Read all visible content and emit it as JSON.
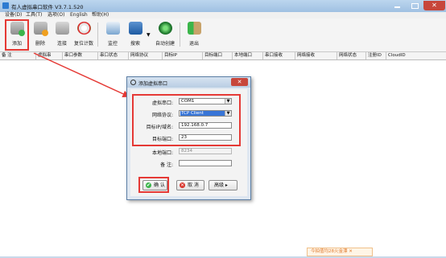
{
  "window": {
    "title": "有人虚拟串口软件 V3.7.1.520",
    "close_glyph": "✕"
  },
  "menu": [
    "设备(D)",
    "工具(T)",
    "选项(O)",
    "English",
    "帮助(H)"
  ],
  "toolbar": {
    "buttons": [
      {
        "label": "添加",
        "icon": "add-port-icon"
      },
      {
        "label": "删除",
        "icon": "delete-port-icon"
      },
      {
        "label": "连接",
        "icon": "connect-icon"
      },
      {
        "label": "复位计数",
        "icon": "reset-counter-icon"
      },
      {
        "label": "监控",
        "icon": "monitor-icon"
      },
      {
        "label": "搜索",
        "icon": "search-device-icon"
      },
      {
        "label": "自动创建",
        "icon": "auto-create-icon"
      },
      {
        "label": "退出",
        "icon": "exit-icon"
      }
    ],
    "search_caret": "▼"
  },
  "grid": {
    "columns": [
      "备 注",
      "虚拟串",
      "串口参数",
      "串口状态",
      "网络协议",
      "目标IP",
      "目标端口",
      "本地端口",
      "串口接收",
      "网络接收",
      "网络状态",
      "注册ID",
      "CloudID"
    ]
  },
  "dialog": {
    "title": "添加虚拟串口",
    "close_glyph": "✕",
    "fields": {
      "virtual_port_label": "虚拟串口:",
      "virtual_port_value": "COM1",
      "protocol_label": "网络协议:",
      "protocol_value": "TCP Client",
      "target_ip_label": "目标IP/域名:",
      "target_ip_value": "192.168.0.7",
      "target_port_label": "目标端口:",
      "target_port_value": "23",
      "local_port_label": "本地端口:",
      "local_port_value": "8234",
      "note_label": "备 注:",
      "note_value": ""
    },
    "buttons": {
      "ok": "确 认",
      "cancel": "取 消",
      "advanced": "高级 ▸",
      "ok_glyph": "✔",
      "cancel_glyph": "✕"
    },
    "dropdown_glyph": "▼"
  },
  "status": {
    "toast": "今拍值均28火金漂 ✕"
  },
  "colors": {
    "annotation_red": "#e53935",
    "selection_blue": "#3875d7"
  }
}
